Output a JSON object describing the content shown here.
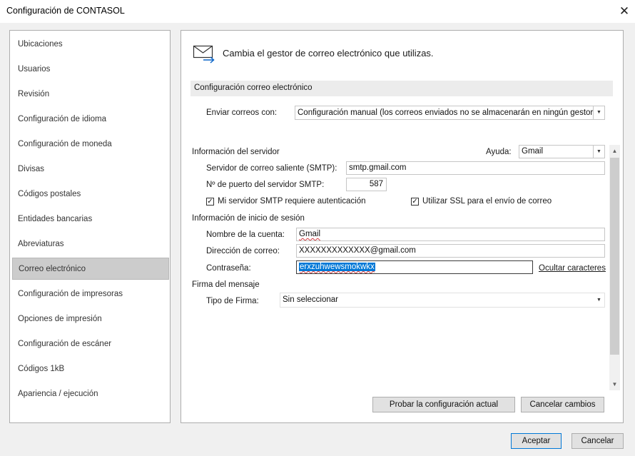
{
  "window": {
    "title": "Configuración de CONTASOL",
    "close_glyph": "✕"
  },
  "nav": {
    "items": [
      {
        "label": "Ubicaciones"
      },
      {
        "label": "Usuarios"
      },
      {
        "label": "Revisión"
      },
      {
        "label": "Configuración de idioma"
      },
      {
        "label": "Configuración de moneda"
      },
      {
        "label": "Divisas"
      },
      {
        "label": "Códigos postales"
      },
      {
        "label": "Entidades bancarias"
      },
      {
        "label": "Abreviaturas"
      },
      {
        "label": "Correo electrónico",
        "selected": true
      },
      {
        "label": "Configuración de impresoras"
      },
      {
        "label": "Opciones de impresión"
      },
      {
        "label": "Configuración de escáner"
      },
      {
        "label": "Códigos 1kB"
      },
      {
        "label": "Apariencia / ejecución"
      }
    ]
  },
  "main": {
    "header": "Cambia el gestor de correo electrónico que utilizas.",
    "section_title": "Configuración correo electrónico",
    "send_with": {
      "label": "Enviar correos con:",
      "value": "Configuración manual (los correos enviados no se almacenarán en ningún gestor de correo)"
    },
    "server": {
      "section_label": "Información del servidor",
      "help_label": "Ayuda:",
      "help_value": "Gmail",
      "smtp_label": "Servidor de correo saliente (SMTP):",
      "smtp_value": "smtp.gmail.com",
      "port_label": "Nº de puerto del servidor SMTP:",
      "port_value": "587",
      "auth_label": "Mi servidor SMTP requiere autenticación",
      "auth_checked": true,
      "ssl_label": "Utilizar SSL para el envío de correo",
      "ssl_checked": true
    },
    "login": {
      "section_label": "Información de inicio de sesión",
      "account_label": "Nombre de la cuenta:",
      "account_value": "Gmail",
      "email_label": "Dirección de correo:",
      "email_value": "XXXXXXXXXXXXX@gmail.com",
      "password_label": "Contraseña:",
      "password_value": "erxzuhwewsmokwkx",
      "hide_chars_link": "Ocultar caracteres"
    },
    "signature": {
      "section_label": "Firma del mensaje",
      "type_label": "Tipo de Firma:",
      "type_value": "Sin seleccionar"
    },
    "buttons": {
      "test": "Probar la configuración actual",
      "cancel_changes": "Cancelar cambios"
    }
  },
  "footer": {
    "accept": "Aceptar",
    "cancel": "Cancelar"
  },
  "icons": {
    "chevron_down": "▼",
    "scroll_up": "▲",
    "scroll_down": "▼",
    "check": "✓"
  }
}
